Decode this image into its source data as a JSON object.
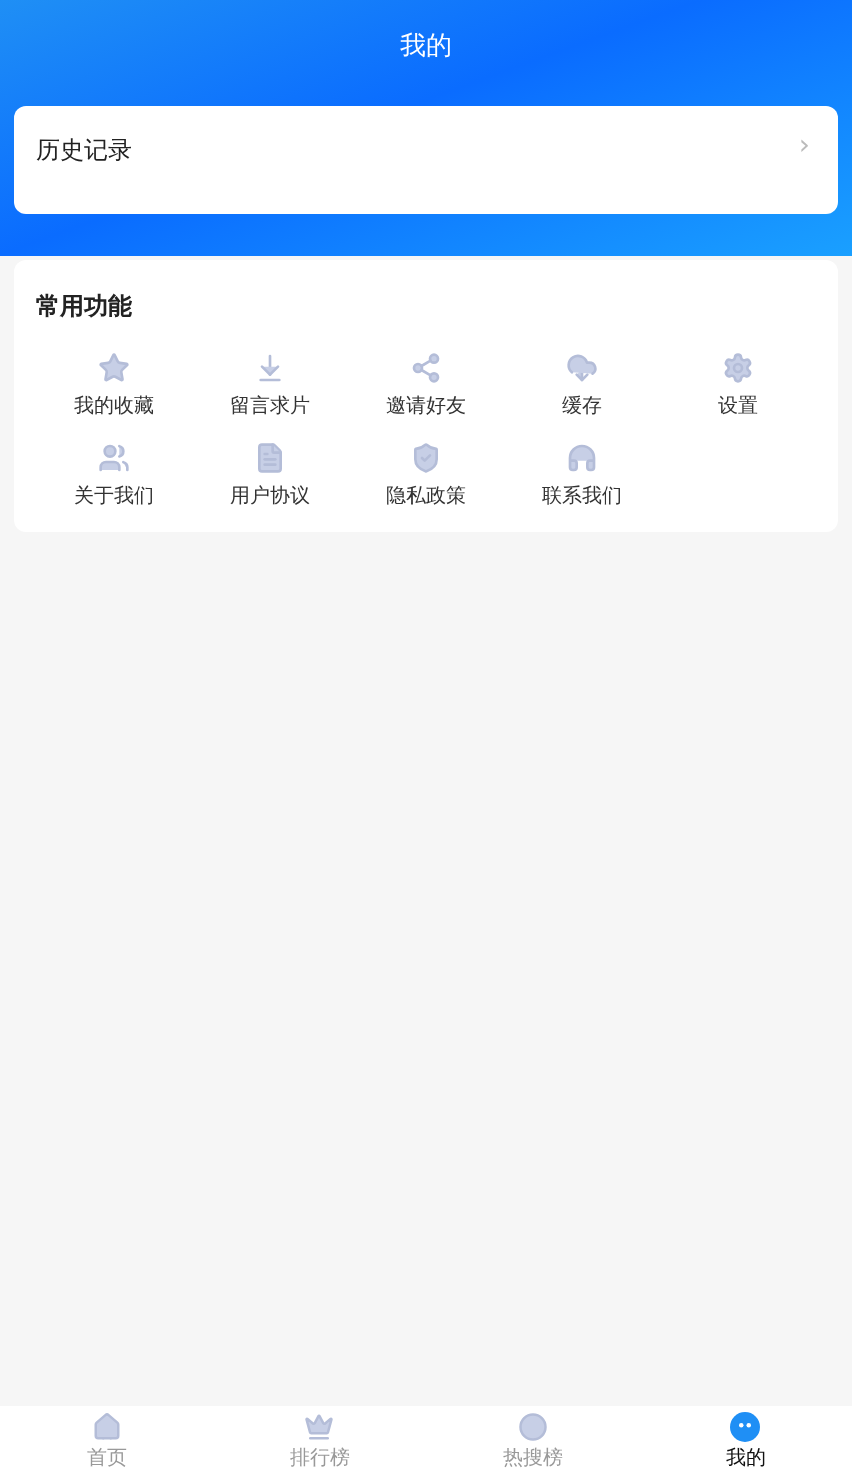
{
  "header": {
    "title": "我的"
  },
  "history": {
    "label": "历史记录",
    "chevron": "›"
  },
  "functions": {
    "title": "常用功能",
    "items": [
      {
        "label": "我的收藏"
      },
      {
        "label": "留言求片"
      },
      {
        "label": "邀请好友"
      },
      {
        "label": "缓存"
      },
      {
        "label": "设置"
      },
      {
        "label": "关于我们"
      },
      {
        "label": "用户协议"
      },
      {
        "label": "隐私政策"
      },
      {
        "label": "联系我们"
      }
    ]
  },
  "tabs": [
    {
      "label": "首页",
      "selected": false
    },
    {
      "label": "排行榜",
      "selected": false
    },
    {
      "label": "热搜榜",
      "selected": false
    },
    {
      "label": "我的",
      "selected": true
    }
  ]
}
